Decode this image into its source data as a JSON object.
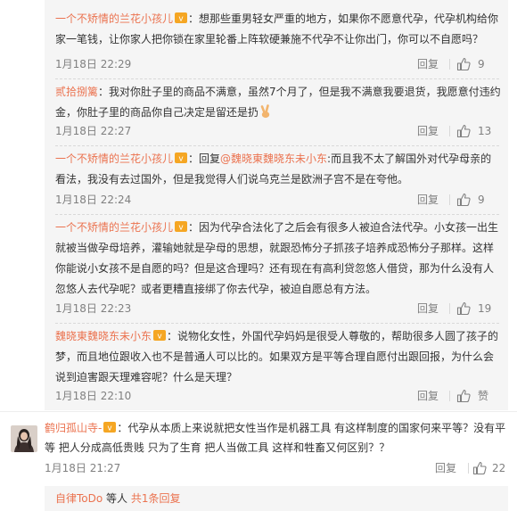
{
  "colors": {
    "accent": "#eb7350",
    "panel_bg": "#f5f5f5",
    "meta": "#808080",
    "text": "#333333"
  },
  "replies": [
    {
      "name": "一个不矫情的兰花小孩儿",
      "text": "：想那些重男轻女严重的地方，如果你不愿意代孕，代孕机构给你家一笔钱，让你家人把你锁在家里轮番上阵软硬兼施不代孕不让你出门，你可以不自愿吗？",
      "time": "1月18日 22:29",
      "reply_label": "回复",
      "likes": "9"
    },
    {
      "name": "贰拾捌篱",
      "text": "：我对你肚子里的商品不满意，虽然7个月了，但是我不满意我要退货，我愿意付违约金，你肚子里的商品你自己决定是留还是扔",
      "time": "1月18日 22:27",
      "reply_label": "回复",
      "likes": "13",
      "emoji": "victory-hand"
    },
    {
      "name": "一个不矫情的兰花小孩儿",
      "reply_prefix": "：回复",
      "mention": "@魏晓東魏晓东未小东",
      "text": ":而且我不太了解国外对代孕母亲的看法，我没有去过国外，但是我觉得人们说乌克兰是欧洲子宫不是在夸他。",
      "time": "1月18日 22:24",
      "reply_label": "回复",
      "likes": "9"
    },
    {
      "name": "一个不矫情的兰花小孩儿",
      "text": "：因为代孕合法化了之后会有很多人被迫合法代孕。小女孩一出生就被当做孕母培养，灌输她就是孕母的思想，就跟恐怖分子抓孩子培养成恐怖分子那样。这样你能说小女孩不是自愿的吗？但是这合理吗？还有现在有高利贷忽悠人借贷，那为什么没有人忽悠人去代孕呢？或者更糟直接绑了你去代孕，被迫自愿总有方法。",
      "time": "1月18日 22:23",
      "reply_label": "回复",
      "likes": "19"
    },
    {
      "name": "魏晓東魏晓东未小东",
      "text": "：说物化女性，外国代孕妈妈是很受人尊敬的，帮助很多人圆了孩子的梦，而且地位跟收入也不是普通人可以比的。如果双方是平等合理自愿付出跟回报，为什么会说到迫害跟天理难容呢？什么是天理？",
      "time": "1月18日 22:10",
      "reply_label": "回复",
      "likes": "赞"
    }
  ],
  "main_comment": {
    "name": "鹤归孤山寺-",
    "text": "：代孕从本质上来说就把女性当作是机器工具 有这样制度的国家何来平等？没有平等 把人分成高低贵贱 只为了生育 把人当做工具 这样和牲畜又何区别？？",
    "time": "1月18日 21:27",
    "reply_label": "回复",
    "likes": "22"
  },
  "sub_replies_bar": {
    "user": "自律ToDo",
    "middle": " 等人 ",
    "count_link": "共1条回复"
  }
}
